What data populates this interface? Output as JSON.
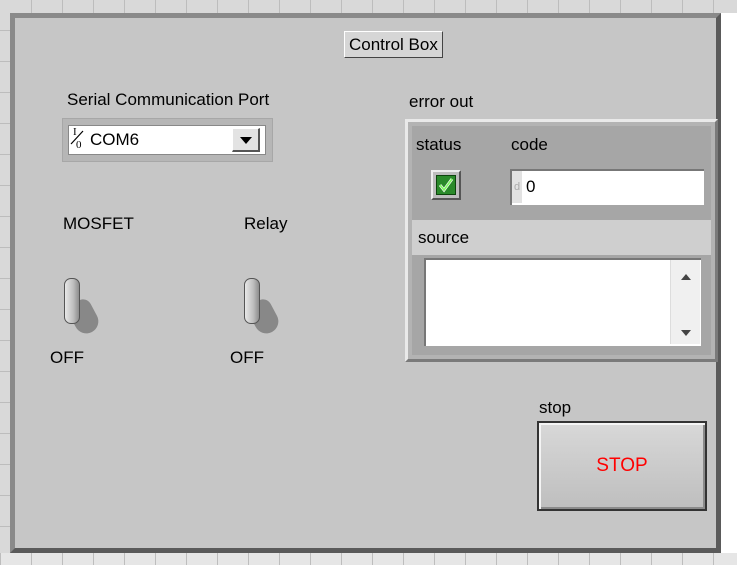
{
  "panel": {
    "title": "Control Box"
  },
  "serial_port": {
    "label": "Serial Communication Port",
    "io_glyph": "I/O",
    "value": "COM6"
  },
  "mosfet": {
    "label": "MOSFET",
    "state": "OFF"
  },
  "relay": {
    "label": "Relay",
    "state": "OFF"
  },
  "error_out": {
    "label": "error out",
    "status_label": "status",
    "code_label": "code",
    "code_radix": "d",
    "code_value": "0",
    "source_label": "source",
    "source_value": ""
  },
  "stop": {
    "label": "stop",
    "button_text": "STOP",
    "button_text_color": "#ff0000"
  },
  "icons": {
    "status": "green-checkmark-icon",
    "dropdown": "triangle-down-icon"
  }
}
